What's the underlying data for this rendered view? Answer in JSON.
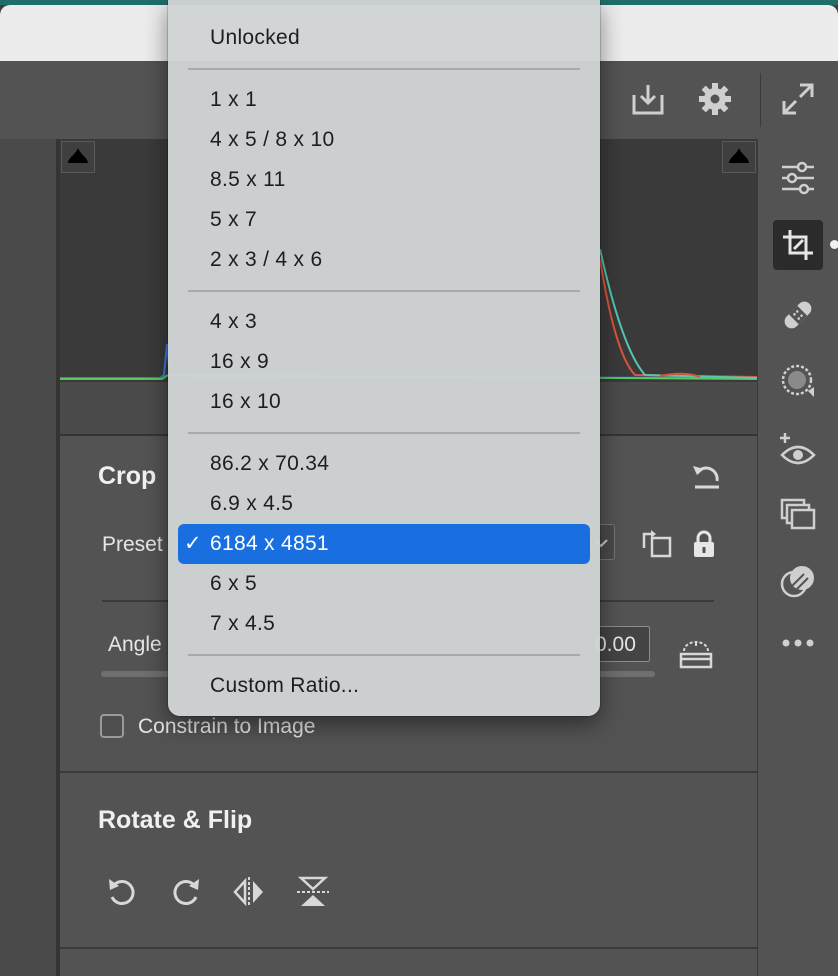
{
  "dropdown": {
    "items": [
      {
        "label": "Unlocked"
      },
      {
        "label": "1 x 1"
      },
      {
        "label": "4 x 5 / 8 x 10"
      },
      {
        "label": "8.5 x 11"
      },
      {
        "label": "5 x 7"
      },
      {
        "label": "2 x 3 / 4 x 6"
      },
      {
        "label": "4 x 3"
      },
      {
        "label": "16 x 9"
      },
      {
        "label": "16 x 10"
      },
      {
        "label": "86.2 x 70.34"
      },
      {
        "label": "6.9 x 4.5"
      },
      {
        "label": "6184 x 4851",
        "selected": true
      },
      {
        "label": "6 x 5"
      },
      {
        "label": "7 x 4.5"
      },
      {
        "label": "Custom Ratio..."
      }
    ],
    "checkmark": "✓"
  },
  "crop": {
    "title": "Crop",
    "preset_label": "Preset",
    "angle_label": "Angle",
    "angle_value": "0.00",
    "constrain_label": "Constrain to Image",
    "constrain_checked": false
  },
  "rotate": {
    "title": "Rotate & Flip"
  },
  "colors": {
    "accent": "#1a6fe0",
    "panel": "#535353",
    "menu_bg": "#cfd4d4"
  }
}
